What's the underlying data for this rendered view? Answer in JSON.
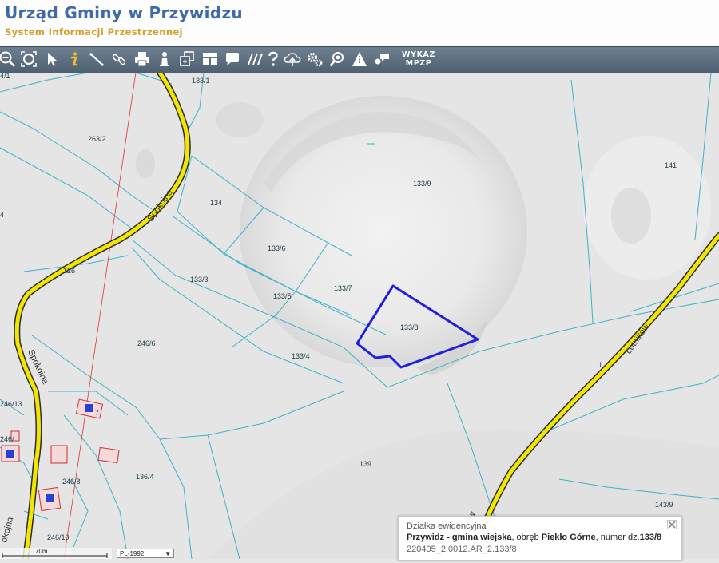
{
  "header": {
    "title": "Urząd Gminy w Przywidzu",
    "subtitle": "System Informacji Przestrzennej"
  },
  "toolbar": {
    "tools": [
      "zoom-out-icon",
      "zoom-extent-icon",
      "select-arrow-icon",
      "info-icon",
      "measure-icon",
      "link-icon",
      "print-icon",
      "person-icon",
      "layers-icon",
      "layout-icon",
      "speech-bubble-icon",
      "hatch-icon",
      "help-icon",
      "upload-cloud-icon",
      "settings-icon",
      "search-zoom-icon",
      "road-sign-icon",
      "comment-icon"
    ],
    "wykaz_line1": "WYKAZ",
    "wykaz_line2": "MPZP"
  },
  "map": {
    "parcels": [
      {
        "id": "p133_1",
        "label": "133/1"
      },
      {
        "id": "p263_2",
        "label": "263/2"
      },
      {
        "id": "p133_9",
        "label": "133/9"
      },
      {
        "id": "p141",
        "label": "141"
      },
      {
        "id": "p134",
        "label": "134"
      },
      {
        "id": "p133_6",
        "label": "133/6"
      },
      {
        "id": "p126",
        "label": "126"
      },
      {
        "id": "p133_3",
        "label": "133/3"
      },
      {
        "id": "p133_7",
        "label": "133/7"
      },
      {
        "id": "p133_5",
        "label": "133/5"
      },
      {
        "id": "p133_8",
        "label": "133/8"
      },
      {
        "id": "p246_6",
        "label": "246/6"
      },
      {
        "id": "p133_4",
        "label": "133/4"
      },
      {
        "id": "p246_13",
        "label": "246/13"
      },
      {
        "id": "p139",
        "label": "139"
      },
      {
        "id": "p136_4",
        "label": "136/4"
      },
      {
        "id": "p246_8",
        "label": "246/8"
      },
      {
        "id": "p143_9",
        "label": "143/9"
      },
      {
        "id": "p246_10",
        "label": "246/10"
      },
      {
        "id": "p_edge_4",
        "label": "4"
      },
      {
        "id": "p_edge_1",
        "label": "1"
      },
      {
        "id": "p_edge_7",
        "label": "7"
      },
      {
        "id": "p_edge_top",
        "label": "4/1"
      },
      {
        "id": "p_edge_246",
        "label": "246/"
      }
    ],
    "streets": [
      {
        "id": "spokojna_upper",
        "label": "Spokojna"
      },
      {
        "id": "spokojna_lower",
        "label": "Spokojna"
      },
      {
        "id": "spokojna_bottom",
        "label": "okojna"
      },
      {
        "id": "lotnikow",
        "label": "Lotników"
      },
      {
        "id": "lotnikow_lower",
        "label": "ków"
      }
    ],
    "highlight_color": "#1f1fe0",
    "road_color": "#f2e600",
    "boundary_color": "#3bb3c7"
  },
  "popup": {
    "title": "Działka ewidencyjna",
    "gmina": "Przywidz - gmina wiejska",
    "text_obreb": ", obręb ",
    "obreb": "Piekło Górne",
    "text_numer": ", numer dz.",
    "numer": "133/8",
    "identifier": "220405_2.0012.AR_2.133/8"
  },
  "scale": {
    "label": "70m",
    "crs": "PL-1992"
  }
}
